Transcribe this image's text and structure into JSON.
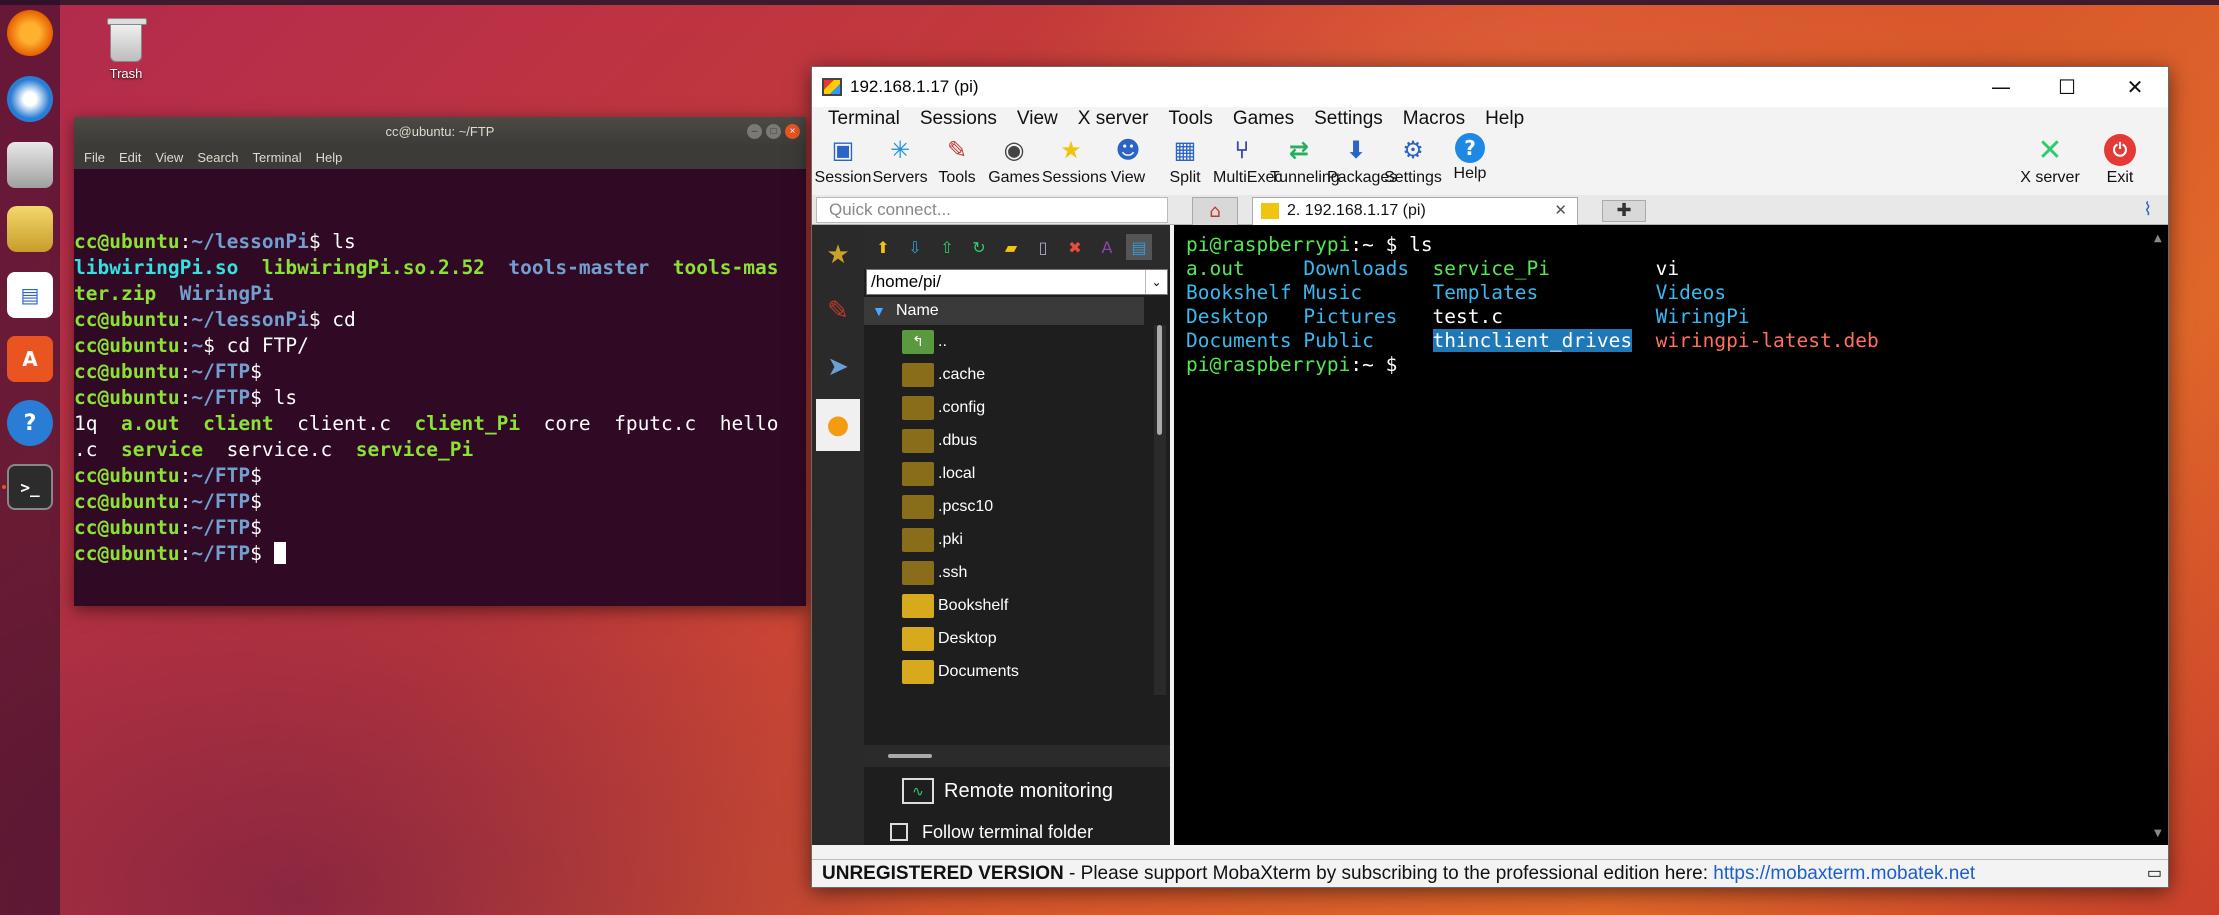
{
  "desktop": {
    "trash_label": "Trash",
    "dock_items": [
      "firefox-icon",
      "thunderbird-icon",
      "files-icon",
      "rhythmbox-icon",
      "writer-icon",
      "software-center-icon",
      "help-icon",
      "terminal-icon"
    ]
  },
  "ubuntu_terminal": {
    "title": "cc@ubuntu: ~/FTP",
    "menu": [
      "File",
      "Edit",
      "View",
      "Search",
      "Terminal",
      "Help"
    ],
    "lines": [
      {
        "parts": [
          {
            "t": "cc@ubuntu",
            "c": "ug"
          },
          {
            "t": ":",
            "c": ""
          },
          {
            "t": "~/lessonPi",
            "c": "ub"
          },
          {
            "t": "$ ls",
            "c": ""
          }
        ]
      },
      {
        "parts": [
          {
            "t": "libwiringPi.so",
            "c": "uc"
          },
          {
            "t": "  ",
            "c": ""
          },
          {
            "t": "libwiringPi.so.2.52",
            "c": "ug"
          },
          {
            "t": "  ",
            "c": ""
          },
          {
            "t": "tools-master",
            "c": "ub"
          },
          {
            "t": "  ",
            "c": ""
          },
          {
            "t": "tools-mas",
            "c": "ug"
          }
        ]
      },
      {
        "parts": [
          {
            "t": "ter.zip",
            "c": "ug"
          },
          {
            "t": "  ",
            "c": ""
          },
          {
            "t": "WiringPi",
            "c": "ub"
          }
        ]
      },
      {
        "parts": [
          {
            "t": "cc@ubuntu",
            "c": "ug"
          },
          {
            "t": ":",
            "c": ""
          },
          {
            "t": "~/lessonPi",
            "c": "ub"
          },
          {
            "t": "$ cd",
            "c": ""
          }
        ]
      },
      {
        "parts": [
          {
            "t": "cc@ubuntu",
            "c": "ug"
          },
          {
            "t": ":",
            "c": ""
          },
          {
            "t": "~",
            "c": "ub"
          },
          {
            "t": "$ cd FTP/",
            "c": ""
          }
        ]
      },
      {
        "parts": [
          {
            "t": "cc@ubuntu",
            "c": "ug"
          },
          {
            "t": ":",
            "c": ""
          },
          {
            "t": "~/FTP",
            "c": "ub"
          },
          {
            "t": "$",
            "c": ""
          }
        ]
      },
      {
        "parts": [
          {
            "t": "cc@ubuntu",
            "c": "ug"
          },
          {
            "t": ":",
            "c": ""
          },
          {
            "t": "~/FTP",
            "c": "ub"
          },
          {
            "t": "$ ls",
            "c": ""
          }
        ]
      },
      {
        "parts": [
          {
            "t": "1q",
            "c": ""
          },
          {
            "t": "  ",
            "c": ""
          },
          {
            "t": "a.out",
            "c": "ug"
          },
          {
            "t": "  ",
            "c": ""
          },
          {
            "t": "client",
            "c": "ug"
          },
          {
            "t": "  client.c  ",
            "c": ""
          },
          {
            "t": "client_Pi",
            "c": "ug"
          },
          {
            "t": "  core  fputc.c  hello",
            "c": ""
          }
        ]
      },
      {
        "parts": [
          {
            "t": ".c  ",
            "c": ""
          },
          {
            "t": "service",
            "c": "ug"
          },
          {
            "t": "  service.c  ",
            "c": ""
          },
          {
            "t": "service_Pi",
            "c": "ug"
          }
        ]
      },
      {
        "parts": [
          {
            "t": "cc@ubuntu",
            "c": "ug"
          },
          {
            "t": ":",
            "c": ""
          },
          {
            "t": "~/FTP",
            "c": "ub"
          },
          {
            "t": "$",
            "c": ""
          }
        ]
      },
      {
        "parts": [
          {
            "t": "cc@ubuntu",
            "c": "ug"
          },
          {
            "t": ":",
            "c": ""
          },
          {
            "t": "~/FTP",
            "c": "ub"
          },
          {
            "t": "$",
            "c": ""
          }
        ]
      },
      {
        "parts": [
          {
            "t": "cc@ubuntu",
            "c": "ug"
          },
          {
            "t": ":",
            "c": ""
          },
          {
            "t": "~/FTP",
            "c": "ub"
          },
          {
            "t": "$",
            "c": ""
          }
        ]
      },
      {
        "parts": [
          {
            "t": "cc@ubuntu",
            "c": "ug"
          },
          {
            "t": ":",
            "c": ""
          },
          {
            "t": "~/FTP",
            "c": "ub"
          },
          {
            "t": "$ ",
            "c": ""
          }
        ],
        "cursor": true
      }
    ]
  },
  "moba": {
    "title": "192.168.1.17 (pi)",
    "menu": [
      "Terminal",
      "Sessions",
      "View",
      "X server",
      "Tools",
      "Games",
      "Settings",
      "Macros",
      "Help"
    ],
    "toolbar": [
      {
        "label": "Session",
        "icon": "session-icon",
        "glyph": "▣",
        "color": "#2a64c6"
      },
      {
        "label": "Servers",
        "icon": "servers-icon",
        "glyph": "✳",
        "color": "#1e8fd8"
      },
      {
        "label": "Tools",
        "icon": "tools-icon",
        "glyph": "✎",
        "color": "#c0392b"
      },
      {
        "label": "Games",
        "icon": "games-icon",
        "glyph": "◉",
        "color": "#444444"
      },
      {
        "label": "Sessions",
        "icon": "star-icon",
        "glyph": "★",
        "color": "#f1c40f"
      },
      {
        "label": "View",
        "icon": "view-icon",
        "glyph": "☻",
        "color": "#2a64c6"
      },
      {
        "label": "Split",
        "icon": "split-icon",
        "glyph": "▦",
        "color": "#2a64c6"
      },
      {
        "label": "MultiExec",
        "icon": "multiexec-icon",
        "glyph": "⑂",
        "color": "#3a4cb0"
      },
      {
        "label": "Tunneling",
        "icon": "tunneling-icon",
        "glyph": "⇄",
        "color": "#27ae60"
      },
      {
        "label": "Packages",
        "icon": "packages-icon",
        "glyph": "⬇",
        "color": "#2a64c6"
      },
      {
        "label": "Settings",
        "icon": "settings-icon",
        "glyph": "⚙",
        "color": "#2a64c6"
      },
      {
        "label": "Help",
        "icon": "help-icon",
        "glyph": "?",
        "color": "#ffffff"
      }
    ],
    "xserver_label": "X server",
    "exit_label": "Exit",
    "quick_connect_placeholder": "Quick connect...",
    "session_tab": "2. 192.168.1.17 (pi)",
    "file_path": "/home/pi/",
    "file_header": "Name",
    "files": [
      {
        "name": "..",
        "kind": "up"
      },
      {
        "name": ".cache",
        "kind": "hidden"
      },
      {
        "name": ".config",
        "kind": "hidden"
      },
      {
        "name": ".dbus",
        "kind": "hidden"
      },
      {
        "name": ".local",
        "kind": "hidden"
      },
      {
        "name": ".pcsc10",
        "kind": "hidden"
      },
      {
        "name": ".pki",
        "kind": "hidden"
      },
      {
        "name": ".ssh",
        "kind": "hidden"
      },
      {
        "name": "Bookshelf",
        "kind": "folder"
      },
      {
        "name": "Desktop",
        "kind": "folder"
      },
      {
        "name": "Documents",
        "kind": "folder"
      }
    ],
    "remote_monitoring": "Remote monitoring",
    "follow_terminal": "Follow terminal folder",
    "terminal_lines": [
      {
        "parts": [
          {
            "t": "pi@raspberrypi",
            "c": "mg"
          },
          {
            "t": ":~ $ ls",
            "c": "mw"
          }
        ]
      },
      {
        "parts": [
          {
            "t": "a.out     ",
            "c": "mg"
          },
          {
            "t": "Downloads  ",
            "c": "mc"
          },
          {
            "t": "service_Pi",
            "c": "mg"
          },
          {
            "t": "         vi",
            "c": "mw"
          }
        ]
      },
      {
        "parts": [
          {
            "t": "Bookshelf ",
            "c": "mc"
          },
          {
            "t": "Music      ",
            "c": "mc"
          },
          {
            "t": "Templates",
            "c": "mc"
          },
          {
            "t": "          ",
            "c": ""
          },
          {
            "t": "Videos",
            "c": "mc"
          }
        ]
      },
      {
        "parts": [
          {
            "t": "Desktop   ",
            "c": "mc"
          },
          {
            "t": "Pictures   ",
            "c": "mc"
          },
          {
            "t": "test.c",
            "c": "mw"
          },
          {
            "t": "             ",
            "c": ""
          },
          {
            "t": "WiringPi",
            "c": "mc"
          }
        ]
      },
      {
        "parts": [
          {
            "t": "Documents ",
            "c": "mc"
          },
          {
            "t": "Public     ",
            "c": "mc"
          },
          {
            "t": "thinclient_drives",
            "c": "mhl"
          },
          {
            "t": "  ",
            "c": ""
          },
          {
            "t": "wiringpi-latest.deb",
            "c": "mr"
          }
        ]
      },
      {
        "parts": [
          {
            "t": "pi@raspberrypi",
            "c": "mg"
          },
          {
            "t": ":~ $",
            "c": "mw"
          }
        ]
      }
    ],
    "status_text": "UNREGISTERED VERSION",
    "status_message": "  -  Please support MobaXterm by subscribing to the professional edition here:  ",
    "status_link": "https://mobaxterm.mobatek.net"
  }
}
